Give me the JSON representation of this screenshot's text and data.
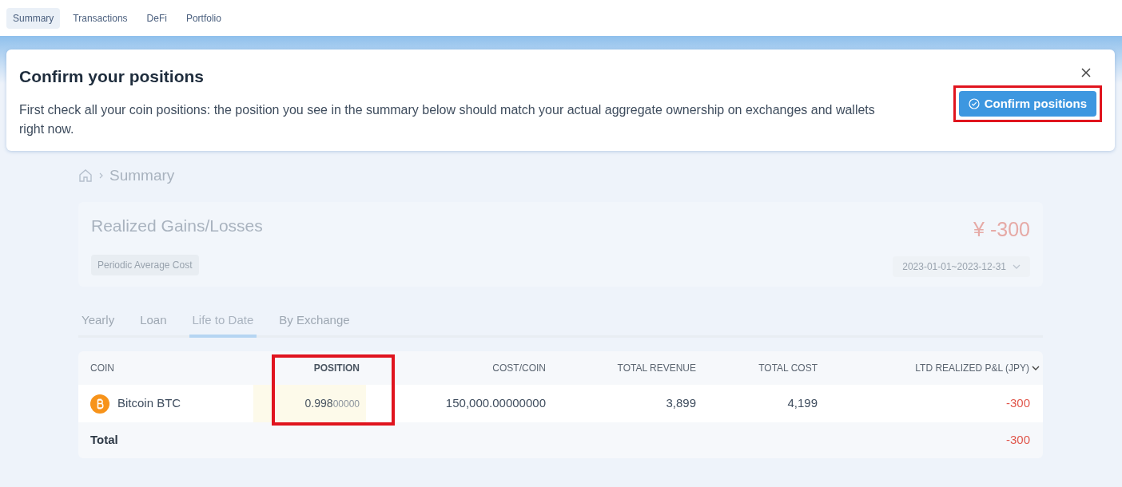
{
  "nav_tabs": [
    {
      "label": "Summary",
      "selected": true
    },
    {
      "label": "Transactions",
      "selected": false
    },
    {
      "label": "DeFi",
      "selected": false
    },
    {
      "label": "Portfolio",
      "selected": false
    }
  ],
  "banner": {
    "title": "Confirm your positions",
    "message": "First check all your coin positions: the position you see in the summary below should match your actual aggregate ownership on exchanges and wallets right now.",
    "button": {
      "label": "Confirm positions",
      "highlighted": true
    }
  },
  "breadcrumb": {
    "current": "Summary"
  },
  "gains_card": {
    "title": "Realized Gains/Losses",
    "method": "Periodic Average Cost",
    "amount": "¥ -300",
    "date_range": "2023-01-01~2023-12-31"
  },
  "tabs": [
    {
      "label": "Yearly",
      "selected": false
    },
    {
      "label": "Loan",
      "selected": false
    },
    {
      "label": "Life to Date",
      "selected": true
    },
    {
      "label": "By Exchange",
      "selected": false
    }
  ],
  "table": {
    "columns": [
      {
        "label": "COIN",
        "highlighted": false
      },
      {
        "label": "POSITION",
        "highlighted": true
      },
      {
        "label": "COST/COIN",
        "highlighted": false
      },
      {
        "label": "TOTAL REVENUE",
        "highlighted": false
      },
      {
        "label": "TOTAL COST",
        "highlighted": false
      },
      {
        "label": "LTD REALIZED P&L (JPY)",
        "highlighted": false
      }
    ],
    "rows": [
      {
        "coin": "Bitcoin BTC",
        "position_main": "0.998",
        "position_trailing": "00000",
        "cost_per_coin": "150,000.00000000",
        "total_revenue": "3,899",
        "total_cost": "4,199",
        "pnl": "-300"
      }
    ],
    "total": {
      "label": "Total",
      "pnl": "-300"
    }
  }
}
